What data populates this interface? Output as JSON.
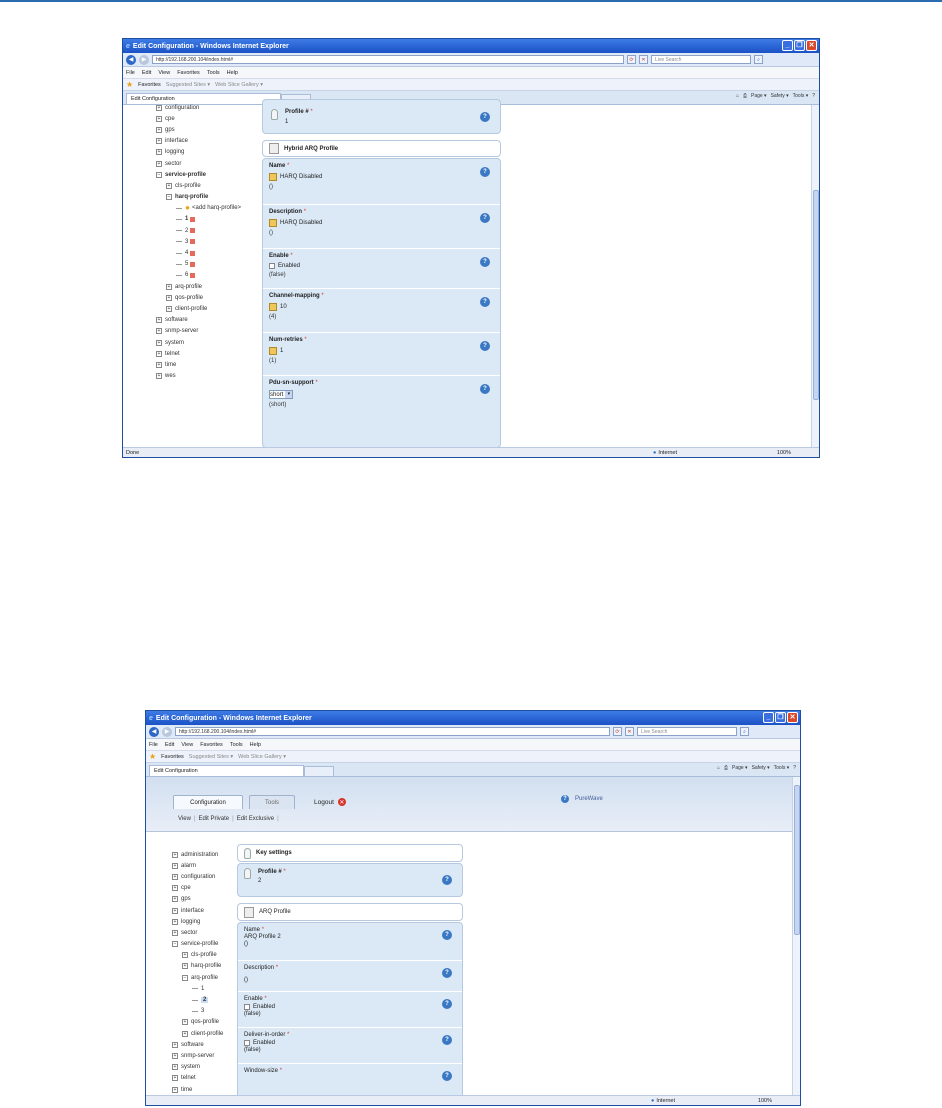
{
  "window1": {
    "title": "Edit Configuration - Windows Internet Explorer",
    "url": "http://192.168.200.104/index.html#",
    "search_placeholder": "Live Search",
    "menu": [
      "File",
      "Edit",
      "View",
      "Favorites",
      "Tools",
      "Help"
    ],
    "favorites_label": "Favorites",
    "favorites_links": [
      "Suggested Sites ▾",
      "Web Slice Gallery ▾"
    ],
    "tab_label": "Edit Configuration",
    "command_bar": [
      "Page ▾",
      "Safety ▾",
      "Tools ▾"
    ],
    "status_text": "Done",
    "zone_text": "Internet",
    "zoom_text": "100%",
    "tree": [
      {
        "label": "configuration",
        "sign": "+",
        "indent": 0
      },
      {
        "label": "cpe",
        "sign": "+",
        "indent": 0
      },
      {
        "label": "gps",
        "sign": "+",
        "indent": 0
      },
      {
        "label": "interface",
        "sign": "+",
        "indent": 0
      },
      {
        "label": "logging",
        "sign": "+",
        "indent": 0
      },
      {
        "label": "sector",
        "sign": "+",
        "indent": 0
      },
      {
        "label": "service-profile",
        "sign": "−",
        "indent": 0,
        "bold": true
      },
      {
        "label": "cls-profile",
        "sign": "+",
        "indent": 1
      },
      {
        "label": "harq-profile",
        "sign": "−",
        "indent": 1,
        "bold": true
      },
      {
        "label": "<add harq-profile>",
        "sign": "",
        "indent": 2,
        "add": true
      },
      {
        "label": "1",
        "sign": "",
        "indent": 2,
        "bold": true,
        "del": true
      },
      {
        "label": "2",
        "sign": "",
        "indent": 2,
        "del": true
      },
      {
        "label": "3",
        "sign": "",
        "indent": 2,
        "del": true
      },
      {
        "label": "4",
        "sign": "",
        "indent": 2,
        "del": true
      },
      {
        "label": "5",
        "sign": "",
        "indent": 2,
        "del": true
      },
      {
        "label": "6",
        "sign": "",
        "indent": 2,
        "del": true
      },
      {
        "label": "arq-profile",
        "sign": "+",
        "indent": 1
      },
      {
        "label": "qos-profile",
        "sign": "+",
        "indent": 1
      },
      {
        "label": "client-profile",
        "sign": "+",
        "indent": 1
      },
      {
        "label": "software",
        "sign": "+",
        "indent": 0
      },
      {
        "label": "snmp-server",
        "sign": "+",
        "indent": 0
      },
      {
        "label": "system",
        "sign": "+",
        "indent": 0
      },
      {
        "label": "telnet",
        "sign": "+",
        "indent": 0
      },
      {
        "label": "time",
        "sign": "+",
        "indent": 0
      },
      {
        "label": "wes",
        "sign": "+",
        "indent": 0
      }
    ],
    "profile_label": "Profile #",
    "profile_value": "1",
    "section_title": "Hybrid ARQ Profile",
    "fields": {
      "name": {
        "label": "Name",
        "value": "HARQ Disabled",
        "default": "()"
      },
      "description": {
        "label": "Description",
        "value": "HARQ Disabled",
        "default": "()"
      },
      "enable": {
        "label": "Enable",
        "value": "Enabled",
        "default": "(false)"
      },
      "channel": {
        "label": "Channel-mapping",
        "value": "10",
        "default": "(4)"
      },
      "retries": {
        "label": "Num-retries",
        "value": "1",
        "default": "(1)"
      },
      "pdu": {
        "label": "Pdu-sn-support",
        "value": "short",
        "default": "(short)"
      }
    }
  },
  "window2": {
    "title": "Edit Configuration - Windows Internet Explorer",
    "url": "http://192.168.200.104/index.html#",
    "search_placeholder": "Live Search",
    "menu": [
      "File",
      "Edit",
      "View",
      "Favorites",
      "Tools",
      "Help"
    ],
    "favorites_label": "Favorites",
    "favorites_links": [
      "Suggested Sites ▾",
      "Web Slice Gallery ▾"
    ],
    "tab_label": "Edit Configuration",
    "command_bar": [
      "Page ▾",
      "Safety ▾",
      "Tools ▾"
    ],
    "zone_text": "Internet",
    "zoom_text": "100%",
    "app_tabs": [
      "Configuration",
      "Tools"
    ],
    "logout": "Logout",
    "brand": "PureWave",
    "subnav": [
      "View",
      "Edit Private",
      "Edit Exclusive"
    ],
    "tree": [
      {
        "label": "administration",
        "sign": "+",
        "indent": 0
      },
      {
        "label": "alarm",
        "sign": "+",
        "indent": 0
      },
      {
        "label": "configuration",
        "sign": "+",
        "indent": 0
      },
      {
        "label": "cpe",
        "sign": "+",
        "indent": 0
      },
      {
        "label": "gps",
        "sign": "+",
        "indent": 0
      },
      {
        "label": "interface",
        "sign": "+",
        "indent": 0
      },
      {
        "label": "logging",
        "sign": "+",
        "indent": 0
      },
      {
        "label": "sector",
        "sign": "+",
        "indent": 0
      },
      {
        "label": "service-profile",
        "sign": "−",
        "indent": 0
      },
      {
        "label": "cls-profile",
        "sign": "+",
        "indent": 1
      },
      {
        "label": "harq-profile",
        "sign": "+",
        "indent": 1
      },
      {
        "label": "arq-profile",
        "sign": "−",
        "indent": 1
      },
      {
        "label": "1",
        "sign": "",
        "indent": 2
      },
      {
        "label": "2",
        "sign": "",
        "indent": 2,
        "bold": true,
        "selected": true
      },
      {
        "label": "3",
        "sign": "",
        "indent": 2
      },
      {
        "label": "qos-profile",
        "sign": "+",
        "indent": 1
      },
      {
        "label": "client-profile",
        "sign": "+",
        "indent": 1
      },
      {
        "label": "software",
        "sign": "+",
        "indent": 0
      },
      {
        "label": "snmp-server",
        "sign": "+",
        "indent": 0
      },
      {
        "label": "system",
        "sign": "+",
        "indent": 0
      },
      {
        "label": "telnet",
        "sign": "+",
        "indent": 0
      },
      {
        "label": "time",
        "sign": "+",
        "indent": 0
      }
    ],
    "key_settings": "Key settings",
    "profile_label": "Profile #",
    "profile_value": "2",
    "section_title": "ARQ Profile",
    "fields": {
      "name": {
        "label": "Name",
        "value": "ARQ Profile 2",
        "default": "()"
      },
      "description": {
        "label": "Description",
        "default": "()"
      },
      "enable": {
        "label": "Enable",
        "value": "Enabled",
        "default": "(false)"
      },
      "deliver": {
        "label": "Deliver-in-order",
        "value": "Enabled",
        "default": "(false)"
      },
      "window": {
        "label": "Window-size"
      }
    }
  }
}
